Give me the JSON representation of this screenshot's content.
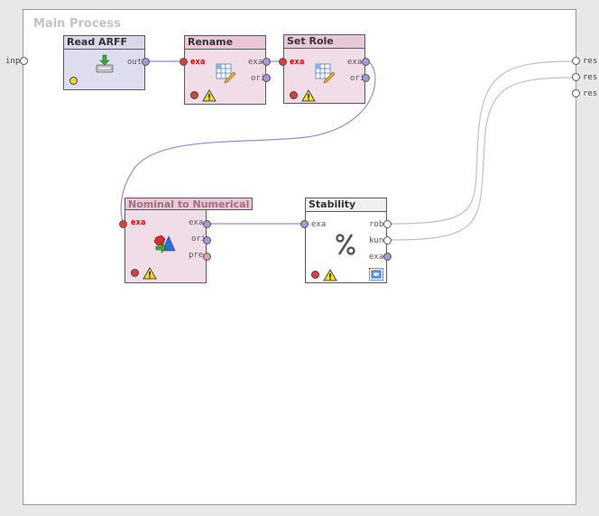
{
  "canvas": {
    "title": "Main Process"
  },
  "outer_ports": {
    "input": "inp",
    "outputs": [
      "res",
      "res",
      "res"
    ]
  },
  "operators": {
    "read_arff": {
      "title": "Read ARFF",
      "out": "out"
    },
    "rename": {
      "title": "Rename",
      "in": "exa",
      "out1": "exa",
      "out2": "ori"
    },
    "set_role": {
      "title": "Set Role",
      "in": "exa",
      "out1": "exa",
      "out2": "ori"
    },
    "nominal_to_numerical": {
      "title": "Nominal to Numerical",
      "in": "exa",
      "out1": "exa",
      "out2": "ori",
      "out3": "pre"
    },
    "stability": {
      "title": "Stability",
      "in": "exa",
      "out1": "rob",
      "out2": "kun",
      "out3": "exa"
    }
  },
  "colors": {
    "header_data": "#d8d8e8",
    "header_preprocess": "#e8c8d8",
    "body_data": "#ddddee",
    "body_preprocess": "#f0dde8",
    "body_eval": "#ffffff",
    "wire_example": "#9a88d8",
    "wire_result": "#c0c0c0",
    "port_example": "#a898d8",
    "port_result": "#ffffff",
    "port_preproc": "#d8a0b0",
    "status_ok": "#e8d840",
    "status_error": "#d84040"
  },
  "icons": {
    "read_arff": "import-data-icon",
    "rename": "table-edit-icon",
    "set_role": "table-edit-icon",
    "nominal_to_numerical": "shapes-convert-icon",
    "stability": "percent-icon",
    "warning": "warning-icon"
  }
}
